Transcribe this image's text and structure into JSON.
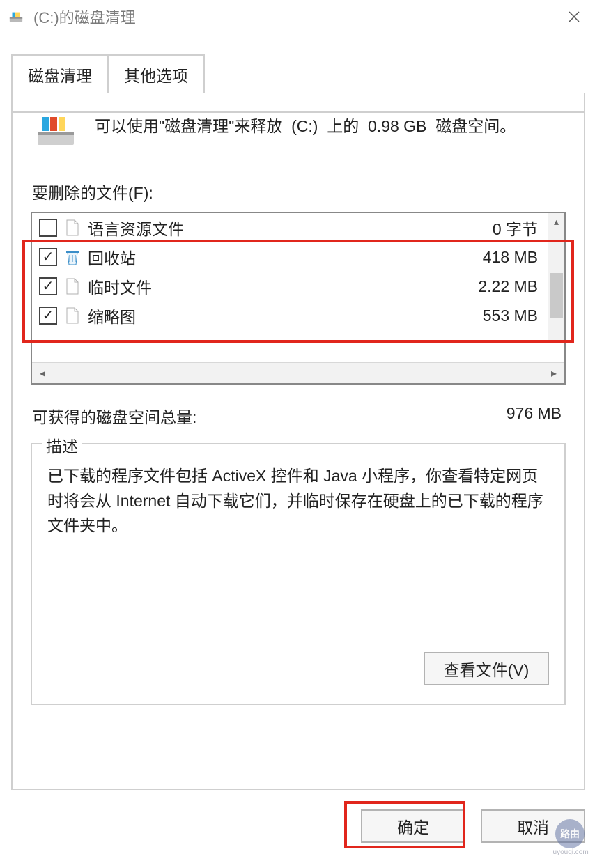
{
  "window": {
    "title": "(C:)的磁盘清理"
  },
  "tabs": {
    "active": "磁盘清理",
    "other": "其他选项"
  },
  "intro": {
    "part1": "可以使用\"磁盘清理\"来释放",
    "drive": "(C:)",
    "part2": "上的",
    "size": "0.98 GB",
    "part3": "磁盘空间。"
  },
  "files_label": "要删除的文件(F):",
  "files": [
    {
      "checked": false,
      "icon": "file",
      "name": "语言资源文件",
      "size": "0 字节"
    },
    {
      "checked": true,
      "icon": "recycle",
      "name": "回收站",
      "size": "418 MB"
    },
    {
      "checked": true,
      "icon": "file",
      "name": "临时文件",
      "size": "2.22 MB"
    },
    {
      "checked": true,
      "icon": "file",
      "name": "缩略图",
      "size": "553 MB"
    }
  ],
  "total": {
    "label": "可获得的磁盘空间总量:",
    "value": "976 MB"
  },
  "description": {
    "legend": "描述",
    "text": "已下载的程序文件包括 ActiveX 控件和 Java 小程序，你查看特定网页时将会从 Internet 自动下载它们，并临时保存在硬盘上的已下载的程序文件夹中。"
  },
  "buttons": {
    "view_files": "查看文件(V)",
    "ok": "确定",
    "cancel": "取消"
  },
  "watermark": {
    "logo": "路由",
    "text": "luyouqi.com"
  }
}
